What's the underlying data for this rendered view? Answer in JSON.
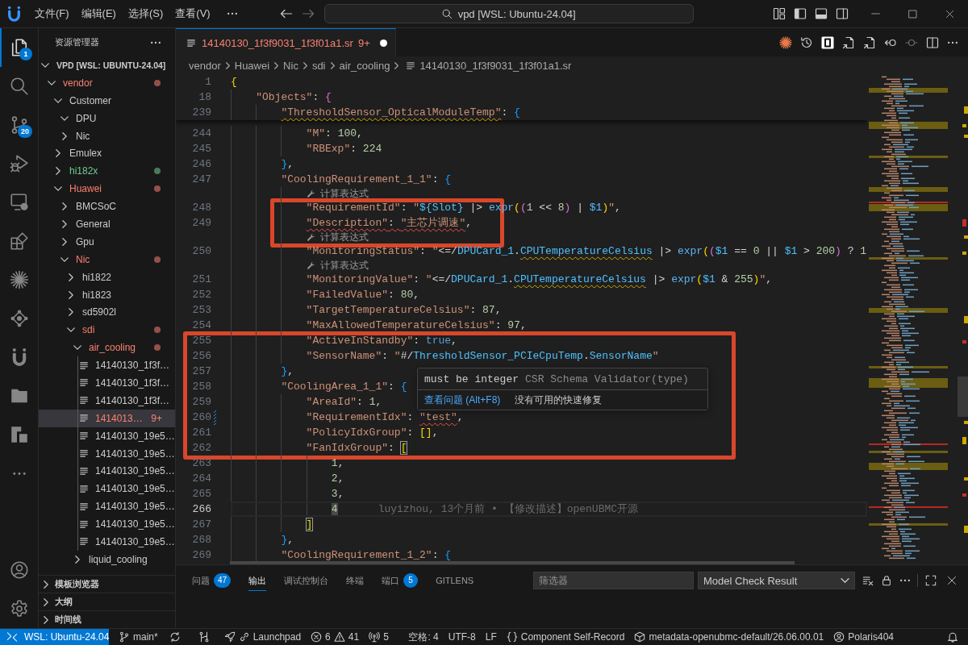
{
  "title_bar": {
    "menu": [
      "文件(F)",
      "编辑(E)",
      "选择(S)",
      "查看(V)"
    ],
    "command_center": "vpd [WSL: Ubuntu-24.04]"
  },
  "activity_bar": {
    "items": [
      {
        "selected": true,
        "badge": "1"
      },
      {
        "selected": false
      },
      {
        "selected": false,
        "badge": "20"
      },
      {
        "selected": false
      },
      {
        "selected": false
      },
      {
        "selected": false
      },
      {
        "selected": false
      },
      {
        "selected": false
      },
      {
        "selected": false
      },
      {
        "selected": false
      },
      {
        "selected": false
      }
    ]
  },
  "sidebar": {
    "title": "资源管理器",
    "workspace": {
      "label": "VPD [WSL: UBUNTU-24.04]",
      "expanded": true,
      "children": [
        {
          "kind": "folder",
          "label": "vendor",
          "expanded": true,
          "selected": false,
          "color": "#f88070",
          "children": [
            {
              "kind": "folder",
              "label": "Customer",
              "expanded": true,
              "selected": false,
              "children": [
                {
                  "kind": "folder",
                  "label": "DPU",
                  "expanded": true,
                  "selected": false
                },
                {
                  "kind": "folder",
                  "label": "Nic",
                  "expanded": false,
                  "selected": false
                }
              ]
            },
            {
              "kind": "folder",
              "label": "Emulex",
              "expanded": false,
              "selected": false
            },
            {
              "kind": "folder",
              "label": "hi182x",
              "expanded": false,
              "selected": false,
              "color": "#73c991"
            },
            {
              "kind": "folder",
              "label": "Huawei",
              "expanded": true,
              "selected": false,
              "color": "#f88070",
              "children": [
                {
                  "kind": "folder",
                  "label": "BMCSoC",
                  "expanded": false,
                  "selected": false
                },
                {
                  "kind": "folder",
                  "label": "General",
                  "expanded": false,
                  "selected": false
                },
                {
                  "kind": "folder",
                  "label": "Gpu",
                  "expanded": false,
                  "selected": false
                },
                {
                  "kind": "folder",
                  "label": "Nic",
                  "expanded": true,
                  "selected": false,
                  "color": "#f88070",
                  "children": [
                    {
                      "kind": "folder",
                      "label": "hi1822",
                      "expanded": false,
                      "selected": false
                    },
                    {
                      "kind": "folder",
                      "label": "hi1823",
                      "expanded": false,
                      "selected": false
                    },
                    {
                      "kind": "folder",
                      "label": "sd5902l",
                      "expanded": false,
                      "selected": false
                    },
                    {
                      "kind": "folder",
                      "label": "sdi",
                      "expanded": true,
                      "selected": false,
                      "color": "#f88070",
                      "children": [
                        {
                          "kind": "folder",
                          "label": "air_cooling",
                          "expanded": true,
                          "selected": false,
                          "color": "#f88070",
                          "children": [
                            {
                              "kind": "file",
                              "label": "14140130_1f3f…",
                              "selected": false
                            },
                            {
                              "kind": "file",
                              "label": "14140130_1f3f…",
                              "selected": false
                            },
                            {
                              "kind": "file",
                              "label": "14140130_1f3f…",
                              "selected": false
                            },
                            {
                              "kind": "file",
                              "label": "1414013…",
                              "selected": true,
                              "color": "#f88070",
                              "badge": "9+"
                            },
                            {
                              "kind": "file",
                              "label": "14140130_19e5…",
                              "selected": false
                            },
                            {
                              "kind": "file",
                              "label": "14140130_19e5…",
                              "selected": false
                            },
                            {
                              "kind": "file",
                              "label": "14140130_19e5…",
                              "selected": false
                            },
                            {
                              "kind": "file",
                              "label": "14140130_19e5…",
                              "selected": false
                            },
                            {
                              "kind": "file",
                              "label": "14140130_19e5…",
                              "selected": false
                            },
                            {
                              "kind": "file",
                              "label": "14140130_19e5…",
                              "selected": false
                            },
                            {
                              "kind": "file",
                              "label": "14140130_19e5…",
                              "selected": false
                            }
                          ]
                        },
                        {
                          "kind": "folder",
                          "label": "liquid_cooling",
                          "expanded": false,
                          "selected": false
                        }
                      ]
                    }
                  ]
                }
              ]
            }
          ]
        }
      ]
    },
    "sections": [
      {
        "label": "模板浏览器",
        "expanded": false
      },
      {
        "label": "大纲",
        "expanded": false
      },
      {
        "label": "时间线",
        "expanded": false
      }
    ]
  },
  "editor": {
    "tabs": [
      {
        "label": "14140130_1f3f9031_1f3f01a1.sr",
        "problems": "9+",
        "color": "#f88070",
        "dirty": true,
        "selected": true
      }
    ],
    "breadcrumbs": [
      "vendor",
      "Huawei",
      "Nic",
      "sdi",
      "air_cooling",
      "14140130_1f3f9031_1f3f01a1.sr"
    ],
    "sticky_lines": [
      {
        "number": "1",
        "tokens": [
          {
            "kind": "bracket1",
            "text": "{"
          }
        ]
      },
      {
        "number": "18",
        "tokens": [
          {
            "kind": "key",
            "text": "    \"Objects\""
          },
          {
            "kind": "punct",
            "text": ": "
          },
          {
            "kind": "bracket2",
            "text": "{"
          }
        ]
      },
      {
        "number": "239",
        "tokens": [
          {
            "kind": "key",
            "text": "        \"ThresholdSensor_OpticalModuleTemp\"",
            "warning": true
          },
          {
            "kind": "punct",
            "text": ": "
          },
          {
            "kind": "bracket3",
            "text": "{"
          }
        ]
      }
    ],
    "rows": [
      {
        "kind": "line",
        "number": "244",
        "tokens": [
          {
            "kind": "key",
            "text": "            \"M\""
          },
          {
            "kind": "punct",
            "text": ": "
          },
          {
            "kind": "number",
            "text": "100"
          },
          {
            "kind": "punct",
            "text": ","
          }
        ]
      },
      {
        "kind": "line",
        "number": "245",
        "tokens": [
          {
            "kind": "key",
            "text": "            \"RBExp\""
          },
          {
            "kind": "punct",
            "text": ": "
          },
          {
            "kind": "number",
            "text": "224"
          }
        ]
      },
      {
        "kind": "line",
        "number": "246",
        "tokens": [
          {
            "kind": "bracket3",
            "text": "        }"
          },
          {
            "kind": "punct",
            "text": ","
          }
        ]
      },
      {
        "kind": "line",
        "number": "247",
        "tokens": [
          {
            "kind": "key",
            "text": "        \"CoolingRequirement_1_1\""
          },
          {
            "kind": "punct",
            "text": ": "
          },
          {
            "kind": "bracket3",
            "text": "{"
          }
        ]
      },
      {
        "kind": "codelens",
        "text": "计算表达式"
      },
      {
        "kind": "frame",
        "rows": [
          {
            "kind": "line",
            "number": "248",
            "tokens": [
              {
                "kind": "key",
                "text": "            \"RequirementId\""
              },
              {
                "kind": "punct",
                "text": ": "
              },
              {
                "kind": "string",
                "text": "\""
              },
              {
                "kind": "variable",
                "text": "${Slot}"
              },
              {
                "kind": "operator",
                "text": " |> "
              },
              {
                "kind": "function",
                "text": "expr"
              },
              {
                "kind": "bracket1",
                "text": "("
              },
              {
                "kind": "bracket2",
                "text": "("
              },
              {
                "kind": "number",
                "text": "1"
              },
              {
                "kind": "operator",
                "text": " << "
              },
              {
                "kind": "number",
                "text": "8"
              },
              {
                "kind": "bracket2",
                "text": ")"
              },
              {
                "kind": "operator",
                "text": " | "
              },
              {
                "kind": "variable",
                "text": "$1"
              },
              {
                "kind": "bracket1",
                "text": ")"
              },
              {
                "kind": "string",
                "text": "\""
              },
              {
                "kind": "punct",
                "text": ","
              }
            ]
          },
          {
            "kind": "line",
            "number": "249",
            "tokens": [
              {
                "kind": "key",
                "text": "            \"Description\"",
                "error": true
              },
              {
                "kind": "punct",
                "text": ": ",
                "error": true
              },
              {
                "kind": "string",
                "text": "\"主芯片调速\"",
                "error": true
              },
              {
                "kind": "punct",
                "text": ","
              }
            ]
          },
          {
            "kind": "codelens",
            "text": "计算表达式"
          }
        ]
      },
      {
        "kind": "line",
        "number": "250",
        "tokens": [
          {
            "kind": "key",
            "text": "            \"MonitoringStatus\""
          },
          {
            "kind": "punct",
            "text": ": "
          },
          {
            "kind": "string",
            "text": "\""
          },
          {
            "kind": "operator",
            "text": "<=/"
          },
          {
            "kind": "variable",
            "text": "DPUCard_1"
          },
          {
            "kind": "operator",
            "text": "."
          },
          {
            "kind": "variable",
            "text": "CPUTemperatureCelsius",
            "warning": true
          },
          {
            "kind": "operator",
            "text": " |> "
          },
          {
            "kind": "function",
            "text": "expr"
          },
          {
            "kind": "bracket1",
            "text": "("
          },
          {
            "kind": "bracket2",
            "text": "("
          },
          {
            "kind": "variable",
            "text": "$1"
          },
          {
            "kind": "operator",
            "text": " == "
          },
          {
            "kind": "number",
            "text": "0"
          },
          {
            "kind": "operator",
            "text": " || "
          },
          {
            "kind": "variable",
            "text": "$1"
          },
          {
            "kind": "operator",
            "text": " > "
          },
          {
            "kind": "number",
            "text": "200"
          },
          {
            "kind": "bracket2",
            "text": ")"
          },
          {
            "kind": "operator",
            "text": " ? "
          },
          {
            "kind": "number",
            "text": "1"
          }
        ]
      },
      {
        "kind": "codelens",
        "text": "计算表达式"
      },
      {
        "kind": "line",
        "number": "251",
        "tokens": [
          {
            "kind": "key",
            "text": "            \"MonitoringValue\""
          },
          {
            "kind": "punct",
            "text": ": "
          },
          {
            "kind": "string",
            "text": "\""
          },
          {
            "kind": "operator",
            "text": "<=/"
          },
          {
            "kind": "variable",
            "text": "DPUCard_1"
          },
          {
            "kind": "operator",
            "text": "."
          },
          {
            "kind": "variable",
            "text": "CPUTemperatureCelsius",
            "warning": true
          },
          {
            "kind": "operator",
            "text": " |> "
          },
          {
            "kind": "function",
            "text": "expr"
          },
          {
            "kind": "bracket1",
            "text": "("
          },
          {
            "kind": "variable",
            "text": "$1"
          },
          {
            "kind": "operator",
            "text": " & "
          },
          {
            "kind": "number",
            "text": "255"
          },
          {
            "kind": "bracket1",
            "text": ")"
          },
          {
            "kind": "string",
            "text": "\""
          },
          {
            "kind": "punct",
            "text": ","
          }
        ]
      },
      {
        "kind": "line",
        "number": "252",
        "tokens": [
          {
            "kind": "key",
            "text": "            \"FailedValue\""
          },
          {
            "kind": "punct",
            "text": ": "
          },
          {
            "kind": "number",
            "text": "80"
          },
          {
            "kind": "punct",
            "text": ","
          }
        ]
      },
      {
        "kind": "line",
        "number": "253",
        "tokens": [
          {
            "kind": "key",
            "text": "            \"TargetTemperatureCelsius\""
          },
          {
            "kind": "punct",
            "text": ": "
          },
          {
            "kind": "number",
            "text": "87"
          },
          {
            "kind": "punct",
            "text": ","
          }
        ]
      },
      {
        "kind": "line",
        "number": "254",
        "tokens": [
          {
            "kind": "key",
            "text": "            \"MaxAllowedTemperatureCelsius\""
          },
          {
            "kind": "punct",
            "text": ": "
          },
          {
            "kind": "number",
            "text": "97"
          },
          {
            "kind": "punct",
            "text": ","
          }
        ]
      },
      {
        "kind": "frame",
        "rows": [
          {
            "kind": "line",
            "number": "255",
            "tokens": [
              {
                "kind": "key",
                "text": "            \"ActiveInStandby\""
              },
              {
                "kind": "punct",
                "text": ": "
              },
              {
                "kind": "boolean",
                "text": "true"
              },
              {
                "kind": "punct",
                "text": ","
              }
            ]
          },
          {
            "kind": "line",
            "number": "256",
            "tokens": [
              {
                "kind": "key",
                "text": "            \"SensorName\""
              },
              {
                "kind": "punct",
                "text": ": "
              },
              {
                "kind": "string",
                "text": "\""
              },
              {
                "kind": "operator",
                "text": "#/"
              },
              {
                "kind": "variable",
                "text": "ThresholdSensor_PCIeCpuTemp"
              },
              {
                "kind": "operator",
                "text": "."
              },
              {
                "kind": "variable",
                "text": "SensorName"
              },
              {
                "kind": "string",
                "text": "\""
              }
            ]
          },
          {
            "kind": "line",
            "number": "257",
            "tokens": [
              {
                "kind": "bracket3",
                "text": "        }"
              },
              {
                "kind": "punct",
                "text": ","
              }
            ]
          },
          {
            "kind": "line",
            "number": "258",
            "tokens": [
              {
                "kind": "key",
                "text": "        \"CoolingArea_1_1\""
              },
              {
                "kind": "punct",
                "text": ": "
              },
              {
                "kind": "bracket3",
                "text": "{"
              }
            ]
          },
          {
            "kind": "line",
            "number": "259",
            "tokens": [
              {
                "kind": "key",
                "text": "            \"AreaId\""
              },
              {
                "kind": "punct",
                "text": ": "
              },
              {
                "kind": "number",
                "text": "1"
              },
              {
                "kind": "punct",
                "text": ","
              }
            ]
          },
          {
            "kind": "line",
            "number": "260",
            "modified": true,
            "tokens": [
              {
                "kind": "key",
                "text": "            \"RequirementIdx\""
              },
              {
                "kind": "punct",
                "text": ": "
              },
              {
                "kind": "string",
                "text": "\"test\"",
                "error": true
              },
              {
                "kind": "punct",
                "text": ","
              }
            ]
          },
          {
            "kind": "line",
            "number": "261",
            "tokens": [
              {
                "kind": "key",
                "text": "            \"PolicyIdxGroup\""
              },
              {
                "kind": "punct",
                "text": ": "
              },
              {
                "kind": "bracket1",
                "text": "["
              },
              {
                "kind": "bracket1",
                "text": "]"
              },
              {
                "kind": "punct",
                "text": ","
              }
            ]
          },
          {
            "kind": "line",
            "number": "262",
            "tokens": [
              {
                "kind": "key",
                "text": "            \"FanIdxGroup\""
              },
              {
                "kind": "punct",
                "text": ": "
              },
              {
                "kind": "bracket1",
                "text": "[",
                "bracket_match": true
              }
            ]
          }
        ]
      },
      {
        "kind": "line",
        "number": "263",
        "tokens": [
          {
            "kind": "number",
            "text": "                1"
          },
          {
            "kind": "punct",
            "text": ","
          }
        ]
      },
      {
        "kind": "line",
        "number": "264",
        "tokens": [
          {
            "kind": "number",
            "text": "                2"
          },
          {
            "kind": "punct",
            "text": ","
          }
        ]
      },
      {
        "kind": "line",
        "number": "265",
        "tokens": [
          {
            "kind": "number",
            "text": "                3"
          },
          {
            "kind": "punct",
            "text": ","
          }
        ]
      },
      {
        "kind": "line",
        "number": "266",
        "current": true,
        "tokens": [
          {
            "kind": "number",
            "text": "                4",
            "word_highlight": true
          }
        ],
        "blame": "luyizhou, 13个月前 • 【修改描述】openUBMC开源"
      },
      {
        "kind": "line",
        "number": "267",
        "tokens": [
          {
            "kind": "bracket1",
            "text": "            ]",
            "bracket_match": true
          }
        ]
      },
      {
        "kind": "line",
        "number": "268",
        "tokens": [
          {
            "kind": "bracket3",
            "text": "        }"
          },
          {
            "kind": "punct",
            "text": ","
          }
        ]
      },
      {
        "kind": "line",
        "number": "269",
        "tokens": [
          {
            "kind": "key",
            "text": "        \"CoolingRequirement_1_2\""
          },
          {
            "kind": "punct",
            "text": ": "
          },
          {
            "kind": "bracket3",
            "text": "{"
          }
        ]
      }
    ],
    "hover": {
      "message": "must be integer",
      "source": "CSR Schema Validator(type)",
      "action": "查看问题 (Alt+F8)",
      "note": "没有可用的快速修复"
    }
  },
  "panel": {
    "tabs": [
      {
        "label": "问题",
        "badge": "47",
        "selected": false
      },
      {
        "label": "输出",
        "selected": true
      },
      {
        "label": "调试控制台",
        "selected": false
      },
      {
        "label": "终端",
        "selected": false
      },
      {
        "label": "端口",
        "badge": "5",
        "selected": false
      },
      {
        "label": "GITLENS",
        "selected": false
      }
    ],
    "filter": {
      "placeholder": "筛选器"
    },
    "channel": "Model Check Result"
  },
  "status_bar": {
    "left": [
      {
        "kind": "remote",
        "text": "WSL: Ubuntu-24.04"
      },
      {
        "kind": "branch",
        "text": "main*"
      },
      {
        "kind": "sync"
      },
      {
        "kind": "graph"
      },
      {
        "kind": "launchpad",
        "text": "Launchpad"
      },
      {
        "kind": "problems",
        "errors": "6",
        "warnings": "41"
      },
      {
        "kind": "ports",
        "text": "5"
      }
    ],
    "right": [
      {
        "kind": "text",
        "text": "空格: 4"
      },
      {
        "kind": "text",
        "text": "UTF-8"
      },
      {
        "kind": "text",
        "text": "LF"
      },
      {
        "kind": "language",
        "text": "Component Self-Record"
      },
      {
        "kind": "package",
        "text": "metadata-openubmc-default/26.06.00.01"
      },
      {
        "kind": "account",
        "text": "Polaris404"
      },
      {
        "kind": "notifications"
      }
    ]
  }
}
